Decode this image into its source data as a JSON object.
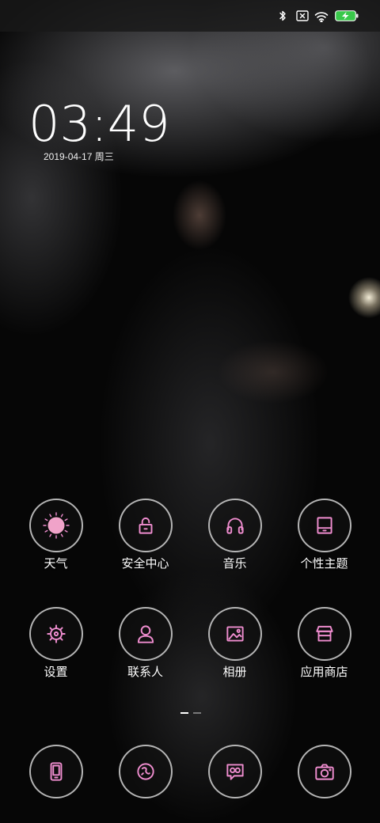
{
  "theme": {
    "accent_color": "#ef8dcf",
    "battery_color": "#39c84a"
  },
  "status_bar": {
    "icons": [
      "bluetooth-icon",
      "no-sim-icon",
      "wifi-icon",
      "battery-charging-icon"
    ]
  },
  "lock": {
    "time": "03:49",
    "date": "2019-04-17 周三"
  },
  "apps": [
    {
      "label": "天气",
      "icon": "weather-sun-icon"
    },
    {
      "label": "安全中心",
      "icon": "lock-icon"
    },
    {
      "label": "音乐",
      "icon": "headphones-icon"
    },
    {
      "label": "个性主题",
      "icon": "theme-icon"
    },
    {
      "label": "设置",
      "icon": "gear-icon"
    },
    {
      "label": "联系人",
      "icon": "contact-icon"
    },
    {
      "label": "相册",
      "icon": "gallery-icon"
    },
    {
      "label": "应用商店",
      "icon": "store-icon"
    }
  ],
  "page_indicator": {
    "pages": 2,
    "active": 0
  },
  "dock": [
    {
      "icon": "phone-icon"
    },
    {
      "icon": "browser-icon"
    },
    {
      "icon": "messages-icon"
    },
    {
      "icon": "camera-icon"
    }
  ]
}
